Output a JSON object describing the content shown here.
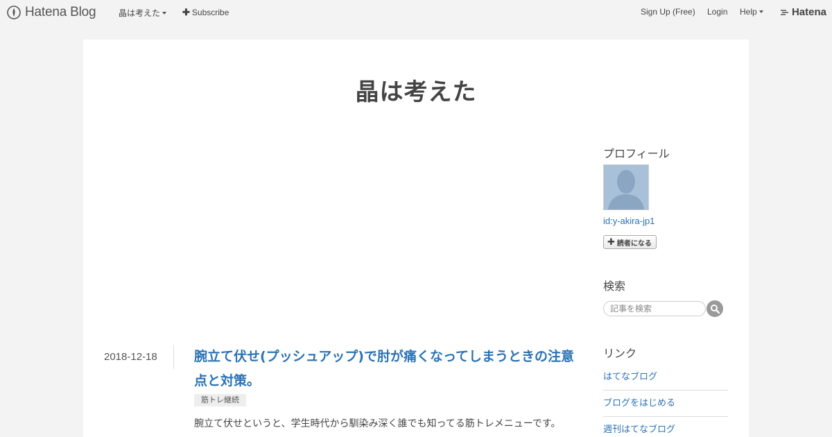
{
  "globalbar": {
    "logo_text": "Hatena Blog",
    "blog_menu_label": "晶は考えた",
    "subscribe_label": "Subscribe",
    "signup_label": "Sign Up (Free)",
    "login_label": "Login",
    "help_label": "Help",
    "hatena_label": "Hatena"
  },
  "blog": {
    "title": "晶は考えた"
  },
  "entry": {
    "date": "2018-12-18",
    "title": "腕立て伏せ(プッシュアップ)で肘が痛くなってしまうときの注意点と対策。",
    "category": "筋トレ継続",
    "excerpt": "腕立て伏せというと、学生時代から馴染み深く誰でも知ってる筋トレメニューです。"
  },
  "sidebar": {
    "profile_heading": "プロフィール",
    "profile_id": "id:y-akira-jp1",
    "subscribe_button": "読者になる",
    "search_heading": "検索",
    "search_placeholder": "記事を検索",
    "links_heading": "リンク",
    "links": [
      {
        "label": "はてなブログ"
      },
      {
        "label": "ブログをはじめる"
      },
      {
        "label": "週刊はてなブログ"
      }
    ]
  },
  "colors": {
    "link": "#2a72b5",
    "page_background": "#f3f3f3",
    "content_background": "#ffffff"
  },
  "icons": [
    "hatena-blog-logo-icon",
    "plus-icon",
    "caret-down-icon",
    "hatena-logo-icon",
    "default-avatar-icon",
    "search-icon"
  ]
}
